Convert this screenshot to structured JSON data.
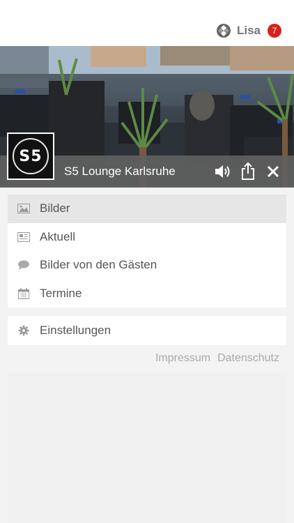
{
  "header": {
    "user_name": "Lisa",
    "notification_count": "7",
    "user_icon": "profile-icon"
  },
  "venue": {
    "logo_text": "S5",
    "title": "S5 Lounge Karlsruhe",
    "actions": [
      "speaker-icon",
      "share-icon",
      "close-icon"
    ]
  },
  "menu": {
    "items": [
      {
        "label": "Bilder",
        "icon": "image-icon",
        "active": true
      },
      {
        "label": "Aktuell",
        "icon": "news-icon",
        "active": false
      },
      {
        "label": "Bilder von den Gästen",
        "icon": "comment-icon",
        "active": false
      },
      {
        "label": "Termine",
        "icon": "calendar-icon",
        "active": false
      }
    ],
    "settings": {
      "label": "Einstellungen",
      "icon": "gear-icon"
    }
  },
  "footer": {
    "impressum": "Impressum",
    "datenschutz": "Datenschutz"
  },
  "colors": {
    "badge": "#d9201c",
    "active_item": "#e6e6e6",
    "hero_bar": "#5f5f5f"
  }
}
